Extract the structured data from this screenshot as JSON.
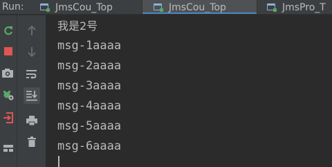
{
  "run_panel": {
    "label": "Run:",
    "tabs": [
      {
        "label": "JmsCou_Top",
        "active": false
      },
      {
        "label": "JmsCou_Top",
        "active": true
      },
      {
        "label": "JmsPro_T",
        "active": false
      }
    ]
  },
  "toolbar_primary": [
    {
      "icon": "rerun-icon",
      "color": "#59a869"
    },
    {
      "icon": "stop-icon",
      "color": "#e05555"
    },
    {
      "icon": "camera-icon",
      "color": "#afb1b3"
    },
    {
      "icon": "debug-settings-icon",
      "color": "#59a869"
    },
    {
      "icon": "exit-icon",
      "color": "#e05555"
    },
    {
      "icon": "layout-icon",
      "color": "#afb1b3"
    }
  ],
  "toolbar_secondary": [
    {
      "icon": "arrow-up-icon"
    },
    {
      "icon": "arrow-down-icon"
    },
    {
      "icon": "soft-wrap-icon"
    },
    {
      "icon": "scroll-to-end-icon",
      "selected": true
    },
    {
      "icon": "print-icon"
    },
    {
      "icon": "trash-icon"
    }
  ],
  "console": {
    "lines": [
      "我是2号",
      "msg-1aaaa",
      "msg-2aaaa",
      "msg-3aaaa",
      "msg-4aaaa",
      "msg-5aaaa",
      "msg-6aaaa"
    ]
  },
  "colors": {
    "background": "#2b2b2b",
    "panel": "#3c3f41",
    "text": "#bbbbbb",
    "accent": "#4a88c7"
  }
}
